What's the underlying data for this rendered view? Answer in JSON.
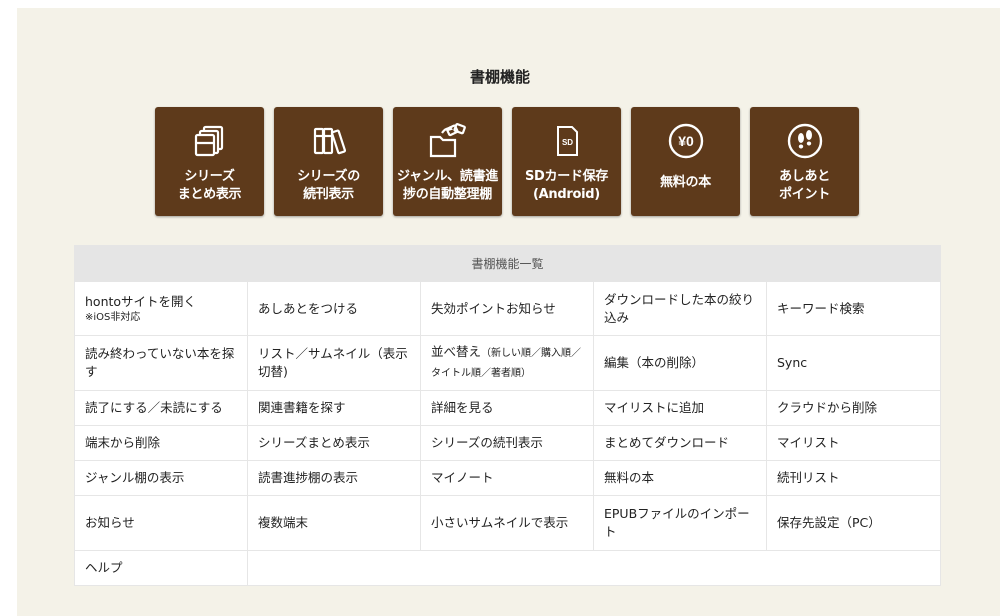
{
  "section_title": "書棚機能",
  "features": [
    {
      "label": "シリーズ\nまとめ表示",
      "icon": "stack-cards-icon"
    },
    {
      "label": "シリーズの\n続刊表示",
      "icon": "books-icon"
    },
    {
      "label": "ジャンル、読書進\n捗の自動整理棚",
      "icon": "folder-sort-icon"
    },
    {
      "label": "SDカード保存\n(Android)",
      "icon": "sd-card-icon"
    },
    {
      "label": "無料の本",
      "icon": "yen-zero-icon"
    },
    {
      "label": "あしあと\nポイント",
      "icon": "footprints-icon"
    }
  ],
  "table": {
    "header": "書棚機能一覧",
    "rows": [
      [
        {
          "text": "hontoサイトを開く",
          "note": "※iOS非対応"
        },
        {
          "text": "あしあとをつける"
        },
        {
          "text": "失効ポイントお知らせ"
        },
        {
          "text": "ダウンロードした本の絞り込み"
        },
        {
          "text": "キーワード検索"
        }
      ],
      [
        {
          "text": "読み終わっていない本を探す"
        },
        {
          "text": "リスト／サムネイル（表示切替)"
        },
        {
          "text": "並べ替え",
          "small": "（新しい順／購入順／タイトル順／著者順）"
        },
        {
          "text": "編集（本の削除）"
        },
        {
          "text": "Sync"
        }
      ],
      [
        {
          "text": "読了にする／未読にする"
        },
        {
          "text": "関連書籍を探す"
        },
        {
          "text": "詳細を見る"
        },
        {
          "text": "マイリストに追加"
        },
        {
          "text": "クラウドから削除"
        }
      ],
      [
        {
          "text": "端末から削除"
        },
        {
          "text": "シリーズまとめ表示"
        },
        {
          "text": "シリーズの続刊表示"
        },
        {
          "text": "まとめてダウンロード"
        },
        {
          "text": "マイリスト"
        }
      ],
      [
        {
          "text": "ジャンル棚の表示"
        },
        {
          "text": "読書進捗棚の表示"
        },
        {
          "text": "マイノート"
        },
        {
          "text": "無料の本"
        },
        {
          "text": "続刊リスト"
        }
      ],
      [
        {
          "text": "お知らせ"
        },
        {
          "text": "複数端末"
        },
        {
          "text": "小さいサムネイルで表示"
        },
        {
          "text": "EPUBファイルのインポート"
        },
        {
          "text": "保存先設定（PC）"
        }
      ],
      [
        {
          "text": "ヘルプ"
        }
      ]
    ]
  },
  "colors": {
    "panel_bg": "#f4f2e8",
    "tile_bg": "#5e3a1b",
    "table_header_bg": "#e5e5e5"
  }
}
